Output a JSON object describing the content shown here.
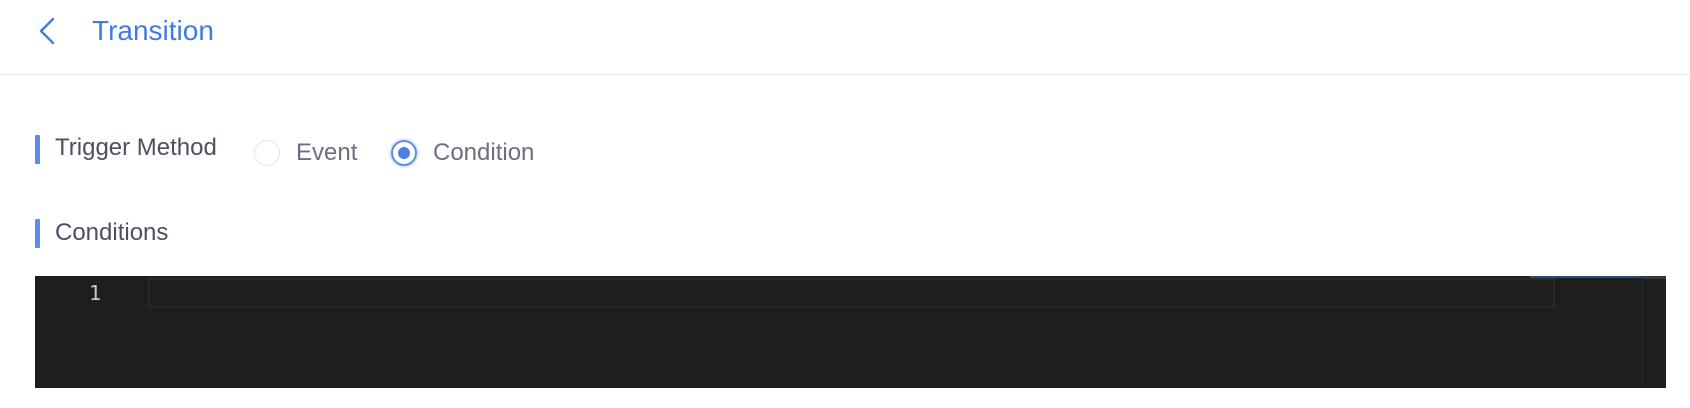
{
  "header": {
    "back_icon": "chevron-left-icon",
    "title": "Transition"
  },
  "trigger_method": {
    "label": "Trigger Method",
    "options": [
      {
        "label": "Event",
        "checked": false
      },
      {
        "label": "Condition",
        "checked": true
      }
    ]
  },
  "conditions": {
    "label": "Conditions",
    "editor": {
      "line_numbers": [
        "1"
      ],
      "content": ""
    }
  },
  "colors": {
    "accent": "#3f7be6",
    "section_bar": "#5a8ee8",
    "editor_bg": "#1e1e1e"
  }
}
